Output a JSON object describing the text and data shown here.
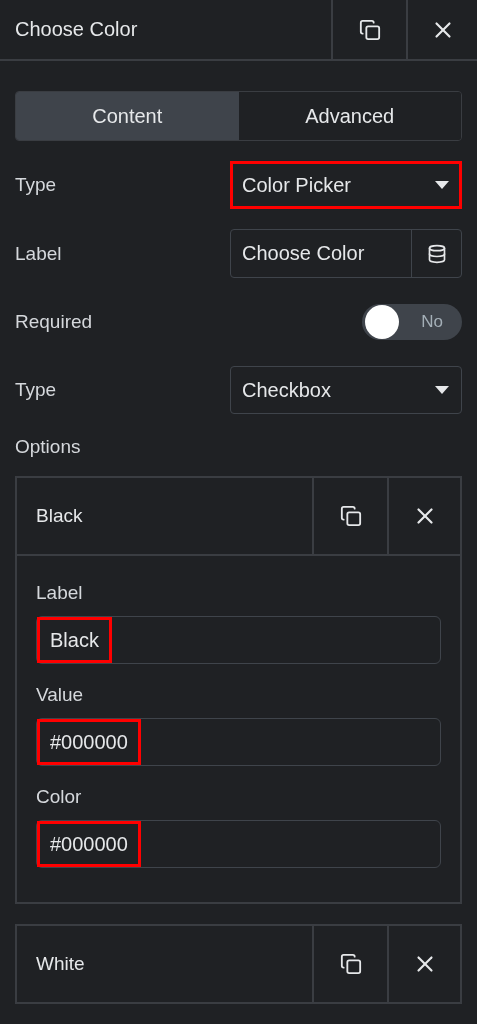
{
  "panel": {
    "title": "Choose Color"
  },
  "tabs": [
    {
      "label": "Content",
      "selected": true
    },
    {
      "label": "Advanced",
      "selected": false
    }
  ],
  "fields": [
    {
      "kind": "select",
      "label": "Type",
      "value": "Color Picker",
      "highlighted": true
    },
    {
      "kind": "text",
      "label": "Label",
      "value": "Choose Color",
      "highlighted": false
    },
    {
      "kind": "toggle",
      "label": "Required",
      "on": false,
      "state_text": "No"
    },
    {
      "kind": "select",
      "label": "Type",
      "value": "Checkbox",
      "highlighted": false
    }
  ],
  "options_label": "Options",
  "options": [
    {
      "title": "Black",
      "expanded": true,
      "fields": [
        {
          "label": "Label",
          "value": "Black",
          "highlighted": true
        },
        {
          "label": "Value",
          "value": "#000000",
          "highlighted": true
        },
        {
          "label": "Color",
          "value": "#000000",
          "highlighted": true
        }
      ]
    },
    {
      "title": "White",
      "expanded": false
    }
  ]
}
